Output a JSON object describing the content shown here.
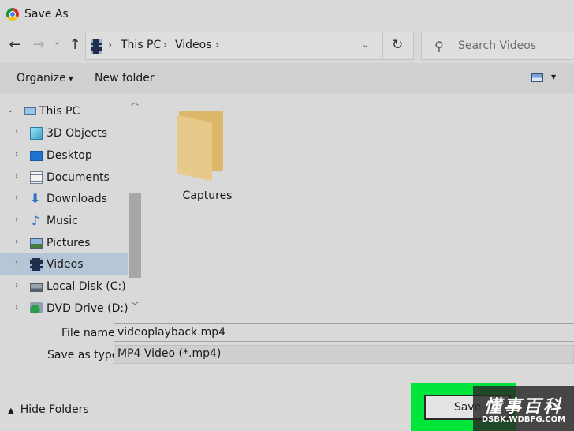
{
  "window": {
    "title": "Save As"
  },
  "nav": {
    "back_glyph": "←",
    "forward_glyph": "→",
    "recent_glyph": "⌄",
    "up_glyph": "↑",
    "breadcrumb": [
      "This PC",
      "Videos"
    ],
    "separator": "›",
    "dropdown_glyph": "⌄",
    "refresh_glyph": "↻"
  },
  "search": {
    "placeholder": "Search Videos"
  },
  "toolbar": {
    "organize_label": "Organize",
    "new_folder_label": "New folder"
  },
  "tree": {
    "items": [
      {
        "label": "This PC",
        "icon": "computer-icon",
        "expander": "⌄"
      },
      {
        "label": "3D Objects",
        "icon": "3d-objects-icon",
        "expander": "›"
      },
      {
        "label": "Desktop",
        "icon": "desktop-icon",
        "expander": "›"
      },
      {
        "label": "Documents",
        "icon": "documents-icon",
        "expander": "›"
      },
      {
        "label": "Downloads",
        "icon": "downloads-icon",
        "expander": "›"
      },
      {
        "label": "Music",
        "icon": "music-icon",
        "expander": "›"
      },
      {
        "label": "Pictures",
        "icon": "pictures-icon",
        "expander": "›"
      },
      {
        "label": "Videos",
        "icon": "videos-icon",
        "expander": "›",
        "selected": true
      },
      {
        "label": "Local Disk (C:)",
        "icon": "local-disk-icon",
        "expander": "›"
      },
      {
        "label": "DVD Drive (D:) C",
        "icon": "dvd-drive-icon",
        "expander": "›"
      }
    ],
    "down_glyph": "⬇",
    "music_glyph": "♪"
  },
  "files": [
    {
      "name": "Captures",
      "icon": "folder-icon"
    }
  ],
  "form": {
    "file_name_label": "File name:",
    "file_name_value": "videoplayback.mp4",
    "save_type_label": "Save as type:",
    "save_type_value": "MP4 Video (*.mp4)"
  },
  "footer": {
    "hide_folders_label": "Hide Folders",
    "save_label": "Save"
  },
  "watermark": {
    "cn": "懂事百科",
    "en": "DSBK.WDBFG.COM"
  },
  "colors": {
    "highlight": "#00e53a",
    "selection": "#b6c6d6",
    "background": "#d9d9d9"
  }
}
